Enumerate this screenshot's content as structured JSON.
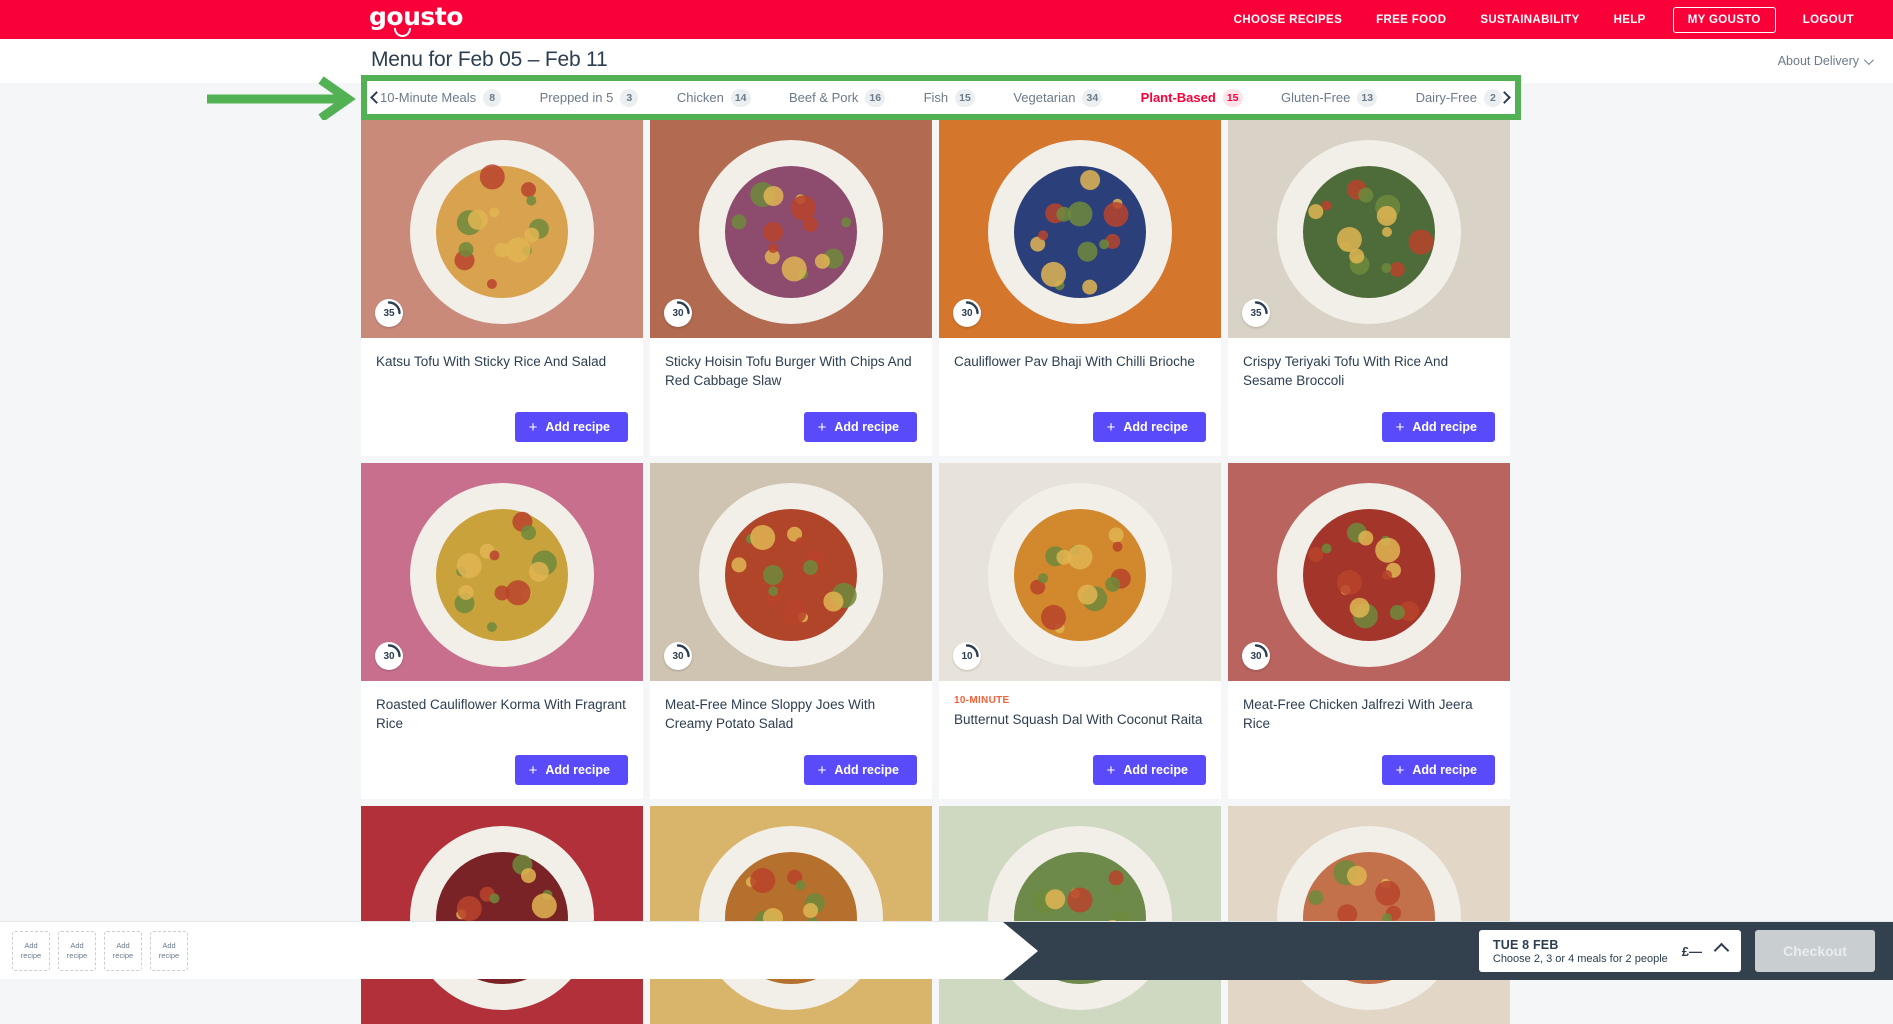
{
  "brand": {
    "name": "gousto",
    "color": "#fa0038",
    "accent_green": "#52b153",
    "accent_purple": "#5a4bfa",
    "dark": "#33414f"
  },
  "topnav": {
    "links": [
      {
        "label": "CHOOSE RECIPES",
        "boxed": false
      },
      {
        "label": "FREE FOOD",
        "boxed": false
      },
      {
        "label": "SUSTAINABILITY",
        "boxed": false
      },
      {
        "label": "HELP",
        "boxed": false
      },
      {
        "label": "MY GOUSTO",
        "boxed": true
      },
      {
        "label": "LOGOUT",
        "boxed": false
      }
    ]
  },
  "subheader": {
    "title": "Menu for Feb 05 – Feb 11",
    "about_delivery": "About Delivery",
    "chevron_icon": "chevron-down-icon"
  },
  "filter_tabs": {
    "left_arrow_icon": "chevron-left-icon",
    "right_arrow_icon": "chevron-right-icon",
    "items": [
      {
        "label": "10-Minute Meals",
        "count": "8",
        "active": false
      },
      {
        "label": "Prepped in 5",
        "count": "3",
        "active": false
      },
      {
        "label": "Chicken",
        "count": "14",
        "active": false
      },
      {
        "label": "Beef & Pork",
        "count": "16",
        "active": false
      },
      {
        "label": "Fish",
        "count": "15",
        "active": false
      },
      {
        "label": "Vegetarian",
        "count": "34",
        "active": false
      },
      {
        "label": "Plant-Based",
        "count": "15",
        "active": true
      },
      {
        "label": "Gluten-Free",
        "count": "13",
        "active": false
      },
      {
        "label": "Dairy-Free",
        "count": "2",
        "active": false
      }
    ]
  },
  "recipes": [
    {
      "title": "Katsu Tofu With Sticky Rice And Salad",
      "time": "35",
      "tag": "",
      "add_label": "Add recipe",
      "img_a": "#c98a7a",
      "img_b": "#d9a24f"
    },
    {
      "title": "Sticky Hoisin Tofu Burger With Chips And Red Cabbage Slaw",
      "time": "30",
      "tag": "",
      "add_label": "Add recipe",
      "img_a": "#b26a50",
      "img_b": "#8d4b6e"
    },
    {
      "title": "Cauliflower Pav Bhaji With Chilli Brioche",
      "time": "30",
      "tag": "",
      "add_label": "Add recipe",
      "img_a": "#d4762c",
      "img_b": "#2b3f7a"
    },
    {
      "title": "Crispy Teriyaki Tofu With Rice And Sesame Broccoli",
      "time": "35",
      "tag": "",
      "add_label": "Add recipe",
      "img_a": "#d9d2c6",
      "img_b": "#4e6b3a"
    },
    {
      "title": "Roasted Cauliflower Korma With Fragrant Rice",
      "time": "30",
      "tag": "",
      "add_label": "Add recipe",
      "img_a": "#c86f8e",
      "img_b": "#c9a23c"
    },
    {
      "title": "Meat-Free Mince Sloppy Joes With Creamy Potato Salad",
      "time": "30",
      "tag": "",
      "add_label": "Add recipe",
      "img_a": "#cfc3b2",
      "img_b": "#b0452a"
    },
    {
      "title": "Butternut Squash Dal With Coconut Raita",
      "time": "10",
      "tag": "10-MINUTE",
      "add_label": "Add recipe",
      "img_a": "#e8e3da",
      "img_b": "#d2882c"
    },
    {
      "title": "Meat-Free Chicken Jalfrezi With Jeera Rice",
      "time": "30",
      "tag": "",
      "add_label": "Add recipe",
      "img_a": "#b9645e",
      "img_b": "#a3352a"
    }
  ],
  "recipes_row3": [
    {
      "img_a": "#b1303a",
      "img_b": "#7a2326"
    },
    {
      "img_a": "#d9b46b",
      "img_b": "#b4702c"
    },
    {
      "img_a": "#cfd8c0",
      "img_b": "#6e8a4a"
    },
    {
      "img_a": "#e2d7c7",
      "img_b": "#c2714a"
    }
  ],
  "bottom_bar": {
    "slots": [
      {
        "line1": "Add",
        "line2": "recipe"
      },
      {
        "line1": "Add",
        "line2": "recipe"
      },
      {
        "line1": "Add",
        "line2": "recipe"
      },
      {
        "line1": "Add",
        "line2": "recipe"
      }
    ],
    "delivery": {
      "date": "TUE 8 FEB",
      "price": "£—",
      "subtitle": "Choose 2, 3 or 4 meals for 2 people",
      "chevron_icon": "chevron-up-icon"
    },
    "checkout_label": "Checkout"
  },
  "annotation": {
    "arrow_icon": "arrow-right-annotation",
    "color": "#52b153"
  }
}
